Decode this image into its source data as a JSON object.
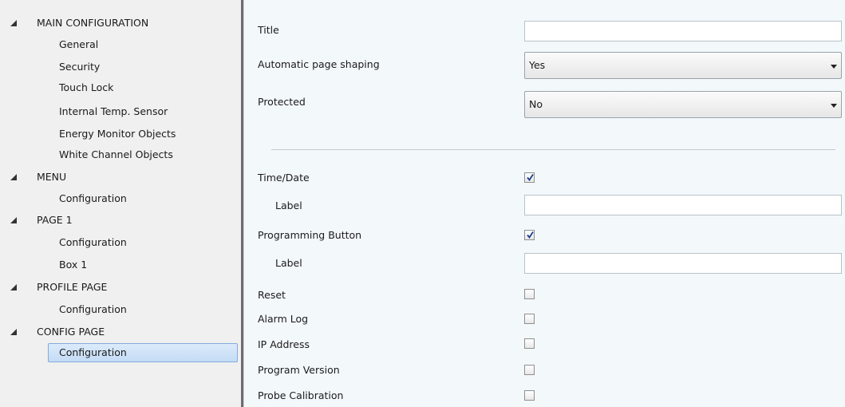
{
  "tree": {
    "groups": [
      {
        "label": "MAIN CONFIGURATION",
        "children": [
          "General",
          "Security",
          "Touch Lock",
          "Internal Temp. Sensor",
          "Energy Monitor Objects",
          "White Channel Objects"
        ]
      },
      {
        "label": "MENU",
        "children": [
          "Configuration"
        ]
      },
      {
        "label": "PAGE 1",
        "children": [
          "Configuration",
          "Box 1"
        ]
      },
      {
        "label": "PROFILE PAGE",
        "children": [
          "Configuration"
        ]
      },
      {
        "label": "CONFIG PAGE",
        "children": [
          "Configuration"
        ]
      }
    ],
    "selected": "CONFIG PAGE > Configuration"
  },
  "params": {
    "title_label": "Title",
    "title_value": "",
    "auto_shaping_label": "Automatic page shaping",
    "auto_shaping_value": "Yes",
    "protected_label": "Protected",
    "protected_value": "No",
    "time_date_label": "Time/Date",
    "time_date_checked": true,
    "time_date_label_label": "Label",
    "time_date_label_value": "",
    "prog_button_label": "Programming Button",
    "prog_button_checked": true,
    "prog_button_label_label": "Label",
    "prog_button_label_value": "",
    "reset_label": "Reset",
    "reset_checked": false,
    "alarm_log_label": "Alarm Log",
    "alarm_log_checked": false,
    "ip_address_label": "IP Address",
    "ip_address_checked": false,
    "program_version_label": "Program Version",
    "program_version_checked": false,
    "probe_calibration_label": "Probe Calibration",
    "probe_calibration_checked": false
  },
  "icons": {
    "expanded": "expanded-triangle-icon",
    "checkmark": "checkmark-icon",
    "dropdown": "chevron-down-icon"
  },
  "colors": {
    "selection": "#c4dcf5",
    "splitter": "#6e6e6e",
    "check": "#1b3f8f"
  }
}
